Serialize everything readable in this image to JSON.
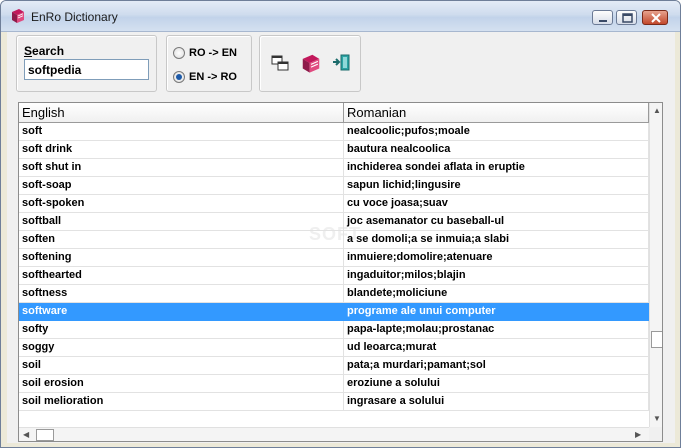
{
  "window": {
    "title": "EnRo Dictionary",
    "accent_color": "#3399ff"
  },
  "search": {
    "label_first": "S",
    "label_rest": "earch",
    "value": "softpedia"
  },
  "direction": {
    "options": [
      {
        "label": "RO -> EN",
        "checked": false
      },
      {
        "label": "EN  -> RO",
        "checked": true
      }
    ]
  },
  "toolbar": {
    "buttons": [
      "windows-icon",
      "book-icon",
      "exit-icon"
    ]
  },
  "grid": {
    "columns": [
      "English",
      "Romanian"
    ],
    "rows": [
      [
        "soft",
        "nealcoolic;pufos;moale"
      ],
      [
        "soft drink",
        "bautura nealcoolica"
      ],
      [
        "soft shut in",
        "inchiderea sondei aflata in eruptie"
      ],
      [
        "soft-soap",
        "sapun lichid;lingusire"
      ],
      [
        "soft-spoken",
        "cu voce joasa;suav"
      ],
      [
        "softball",
        "joc asemanator cu baseball-ul"
      ],
      [
        "soften",
        "a se domoli;a se inmuia;a slabi"
      ],
      [
        "softening",
        "inmuiere;domolire;atenuare"
      ],
      [
        "softhearted",
        "ingaduitor;milos;blajin"
      ],
      [
        "softness",
        "blandete;moliciune"
      ],
      [
        "software",
        "programe ale unui computer"
      ],
      [
        "softy",
        "papa-lapte;molau;prostanac"
      ],
      [
        "soggy",
        "ud leoarca;murat"
      ],
      [
        "soil",
        "pata;a murdari;pamant;sol"
      ],
      [
        "soil erosion",
        "eroziune a solului"
      ],
      [
        "soil melioration",
        "ingrasare a solului"
      ]
    ],
    "selected_index": 10
  }
}
